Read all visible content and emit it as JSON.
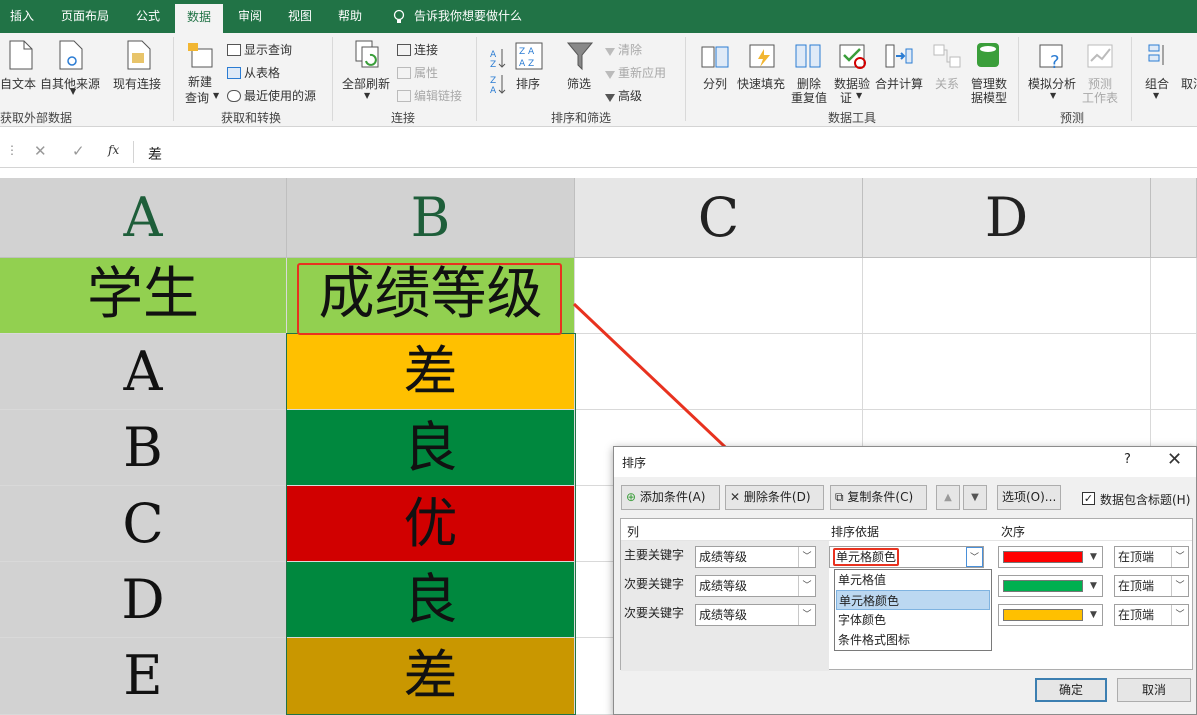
{
  "ribbon_tabs": [
    "插入",
    "页面布局",
    "公式",
    "数据",
    "审阅",
    "视图",
    "帮助"
  ],
  "tell_me": "告诉我你想要做什么",
  "ribbon": {
    "get_external": {
      "from_text": "自文本",
      "from_other": "自其他来源",
      "existing": "现有连接",
      "group": "获取外部数据"
    },
    "get_transform": {
      "new_query": "新建",
      "new_query2": "查询",
      "show_queries": "显示查询",
      "from_table": "从表格",
      "recent_sources": "最近使用的源",
      "group": "获取和转换"
    },
    "connections": {
      "refresh_all": "全部刷新",
      "connections": "连接",
      "properties": "属性",
      "edit_links": "编辑链接",
      "group": "连接"
    },
    "sort_filter": {
      "sort": "排序",
      "filter": "筛选",
      "clear": "清除",
      "reapply": "重新应用",
      "advanced": "高级",
      "group": "排序和筛选"
    },
    "data_tools": {
      "split": "分列",
      "flash_fill": "快速填充",
      "remove_dup": "删除",
      "remove_dup2": "重复值",
      "validation": "数据验",
      "validation2": "证",
      "consolidate": "合并计算",
      "relations": "关系",
      "manage_model": "管理数",
      "manage_model2": "据模型",
      "group": "数据工具"
    },
    "forecast": {
      "what_if": "模拟分析",
      "forecast_sheet": "预测",
      "forecast_sheet2": "工作表",
      "group": "预测"
    },
    "outline": {
      "group_btn": "组合",
      "ungroup": "取消"
    }
  },
  "formula_bar": {
    "fx": "fx",
    "content": "差"
  },
  "columns": [
    "A",
    "B",
    "C",
    "D"
  ],
  "header_row": {
    "a": "学生",
    "b": "成绩等级"
  },
  "rows": [
    {
      "student": "A",
      "grade": "差",
      "color": "#ffc000"
    },
    {
      "student": "B",
      "grade": "良",
      "color": "#00883e"
    },
    {
      "student": "C",
      "grade": "优",
      "color": "#d10000"
    },
    {
      "student": "D",
      "grade": "良",
      "color": "#00883e"
    },
    {
      "student": "E",
      "grade": "差",
      "color": "#c99700"
    }
  ],
  "header_color": "#92d050",
  "sort_dialog": {
    "title": "排序",
    "help": "?",
    "add_level": "添加条件(A)",
    "delete_level": "删除条件(D)",
    "copy_level": "复制条件(C)",
    "options": "选项(O)...",
    "has_headers": "数据包含标题(H)",
    "col_header": "列",
    "sort_on_header": "排序依据",
    "order_header": "次序",
    "levels": [
      {
        "label": "主要关键字",
        "column": "成绩等级",
        "sort_on": "单元格颜色",
        "color": "#ff0000",
        "position": "在顶端"
      },
      {
        "label": "次要关键字",
        "column": "成绩等级",
        "sort_on": "",
        "color": "#00b050",
        "position": "在顶端"
      },
      {
        "label": "次要关键字",
        "column": "成绩等级",
        "sort_on": "",
        "color": "#ffc000",
        "position": "在顶端"
      }
    ],
    "sort_on_options": [
      "单元格值",
      "单元格颜色",
      "字体颜色",
      "条件格式图标"
    ],
    "selected_option": "单元格颜色",
    "ok": "确定",
    "cancel": "取消"
  },
  "accent": "#217346",
  "annotation_color": "#e8321f"
}
